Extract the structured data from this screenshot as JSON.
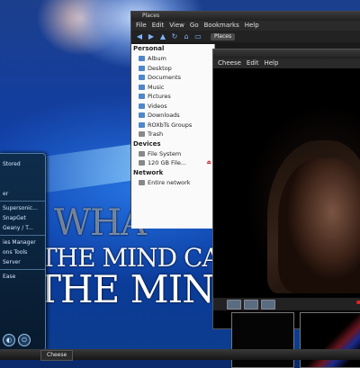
{
  "wallpaper": {
    "line1": "WHA",
    "line2": "THE MIND CAN C",
    "line3": "THE MIND C"
  },
  "dock": {
    "items": [
      "Stored",
      "",
      "",
      "er",
      "",
      "Supersonic...",
      "SnapGet",
      "Geany / T...",
      "",
      "ies Manager",
      "ons Tools",
      "Server",
      "",
      "Ease"
    ],
    "buttons": [
      "◐",
      "⏻"
    ]
  },
  "file_manager": {
    "title": "Places",
    "menu": [
      "File",
      "Edit",
      "View",
      "Go",
      "Bookmarks",
      "Help"
    ],
    "toolbar_path": "Places",
    "personal_header": "Personal",
    "personal_items": [
      "Album",
      "Desktop",
      "Documents",
      "Music",
      "Pictures",
      "Videos",
      "Downloads",
      "ROXbTs Groups",
      "Trash"
    ],
    "devices_header": "Devices",
    "device_items": [
      "File System",
      "120 GB File..."
    ],
    "network_header": "Network",
    "network_items": [
      "Entire network"
    ]
  },
  "video_window": {
    "title": "Cheese",
    "menu": [
      "Cheese",
      "Edit",
      "Help"
    ]
  },
  "taskbar": {
    "task_label": "Cheese"
  },
  "colors": {
    "wallpaper_blue": "#0f3ea8",
    "record_button": "#dd2222"
  }
}
